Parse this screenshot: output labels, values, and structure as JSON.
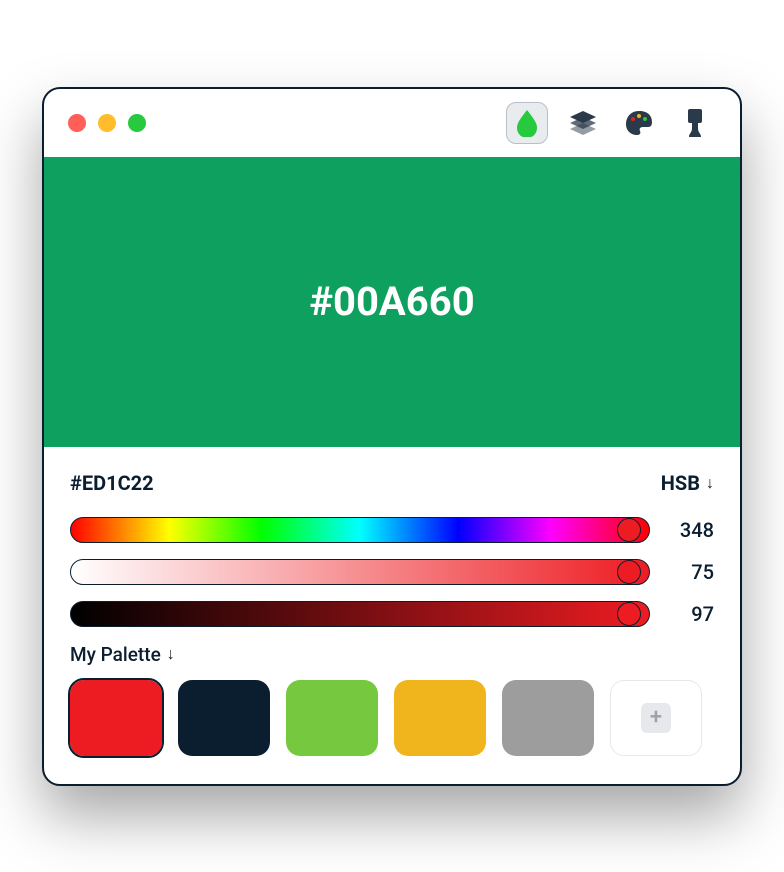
{
  "preview": {
    "hex_label": "#00A660",
    "bg": "#0ea05f"
  },
  "picker": {
    "hex": "#ED1C22",
    "mode_label": "HSB",
    "hue": 348,
    "saturation": 75,
    "brightness": 97,
    "hue_thumb_pct": 96.5,
    "sat_thumb_pct": 96.5,
    "bri_thumb_pct": 96.5,
    "accent": "#ed1c22"
  },
  "palette": {
    "header": "My Palette",
    "swatches": [
      {
        "color": "#ed1c22",
        "selected": true
      },
      {
        "color": "#0b1e30",
        "selected": false
      },
      {
        "color": "#76c83f",
        "selected": false
      },
      {
        "color": "#f0b41c",
        "selected": false
      },
      {
        "color": "#9d9d9d",
        "selected": false
      }
    ]
  },
  "toolbar": {
    "drop_color": "#27c93f"
  }
}
